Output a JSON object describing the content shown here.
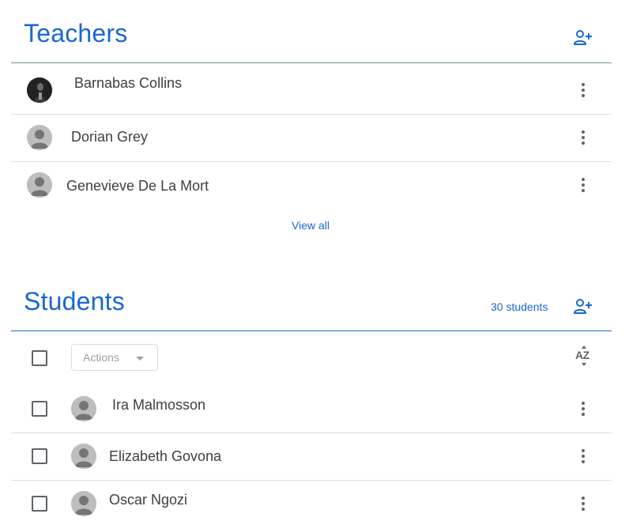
{
  "teachers": {
    "title": "Teachers",
    "add_icon": "person-add-icon",
    "items": [
      {
        "name": "Barnabas Collins",
        "avatar": "photo",
        "menu_icon": "more-vert-icon"
      },
      {
        "name": "Dorian Grey",
        "avatar": "default-person-icon",
        "menu_icon": "more-vert-icon"
      },
      {
        "name": "Genevieve De La Mort",
        "avatar": "default-person-icon",
        "menu_icon": "more-vert-icon"
      }
    ],
    "view_all": "View all"
  },
  "students": {
    "title": "Students",
    "count": "30 students",
    "add_icon": "person-add-icon",
    "actions_label": "Actions",
    "sort_icon": "sort-az-icon",
    "sort_label": "AZ",
    "items": [
      {
        "name": "Ira Malmosson"
      },
      {
        "name": "Elizabeth Govona"
      },
      {
        "name": "Oscar Ngozi"
      }
    ]
  },
  "colors": {
    "accent": "#1967d2",
    "text": "#3c4043",
    "muted": "#5f6368",
    "divider": "#e0e0e0"
  }
}
